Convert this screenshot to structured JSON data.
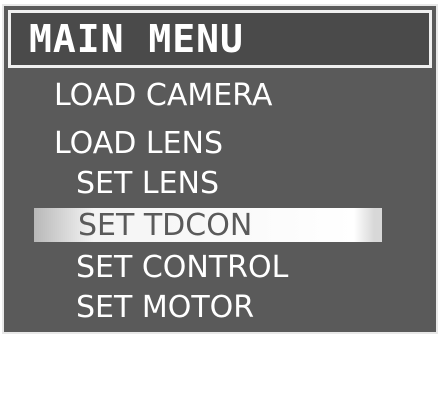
{
  "menu": {
    "title": "MAIN MENU",
    "items": [
      {
        "label": "LOAD CAMERA",
        "selected": false
      },
      {
        "label": "LOAD LENS",
        "selected": false
      },
      {
        "label": "SET LENS",
        "selected": false
      },
      {
        "label": "SET TDCON",
        "selected": true
      },
      {
        "label": "SET CONTROL",
        "selected": false
      },
      {
        "label": "SET MOTOR",
        "selected": false
      }
    ]
  },
  "colors": {
    "background": "#5a5a5a",
    "text": "#ffffff",
    "highlight": "#f4f4f4"
  }
}
